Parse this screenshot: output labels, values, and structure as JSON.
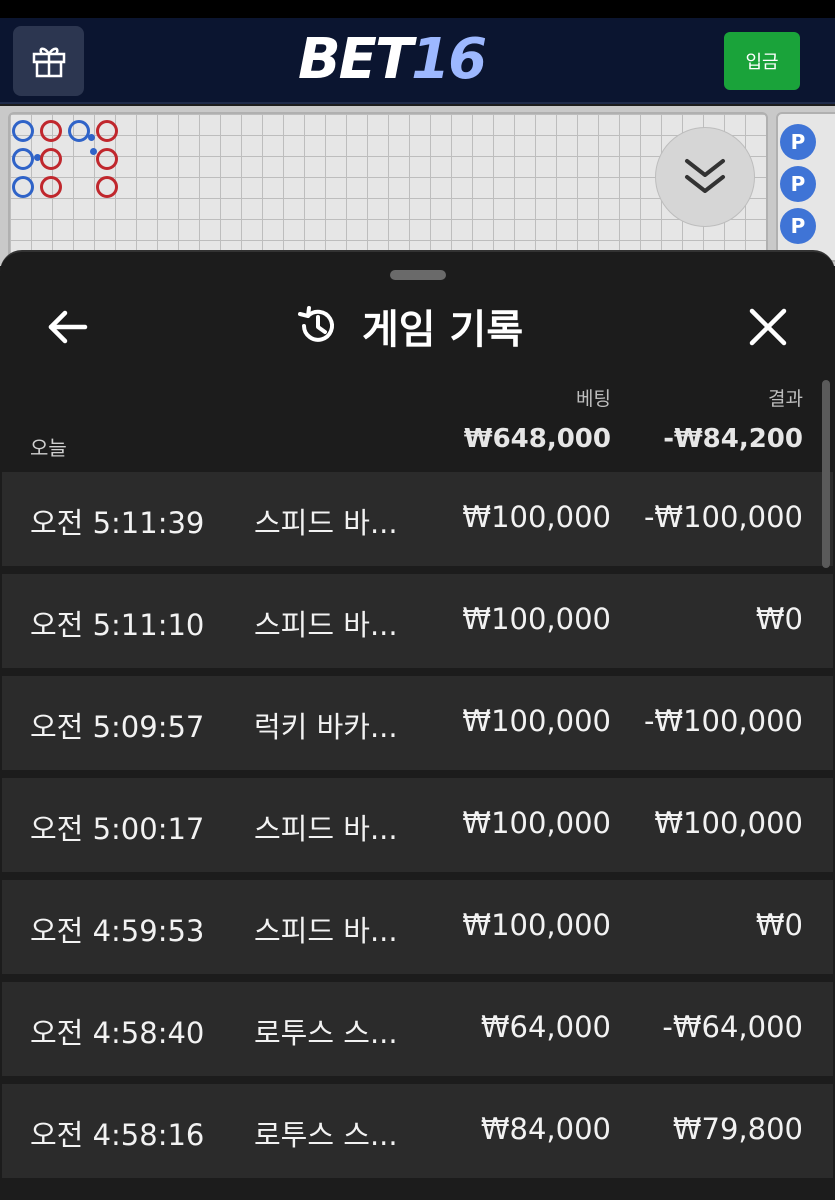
{
  "header": {
    "logo_text_main": "BET",
    "logo_text_accent": "16",
    "deposit_label": "입금"
  },
  "roadmap": {
    "side_chip_label": "P"
  },
  "sheet": {
    "title": "게임 기록",
    "columns": {
      "bet": "베팅",
      "result": "결과"
    },
    "today_label": "오늘",
    "total_bet": "₩648,000",
    "total_result": "-₩84,200",
    "rows": [
      {
        "time": "오전 5:11:39",
        "game": "스피드 바...",
        "bet": "₩100,000",
        "result": "-₩100,000"
      },
      {
        "time": "오전 5:11:10",
        "game": "스피드 바...",
        "bet": "₩100,000",
        "result": "₩0"
      },
      {
        "time": "오전 5:09:57",
        "game": "럭키 바카...",
        "bet": "₩100,000",
        "result": "-₩100,000"
      },
      {
        "time": "오전 5:00:17",
        "game": "스피드 바...",
        "bet": "₩100,000",
        "result": "₩100,000"
      },
      {
        "time": "오전 4:59:53",
        "game": "스피드 바...",
        "bet": "₩100,000",
        "result": "₩0"
      },
      {
        "time": "오전 4:58:40",
        "game": "로투스 스...",
        "bet": "₩64,000",
        "result": "-₩64,000"
      },
      {
        "time": "오전 4:58:16",
        "game": "로투스 스...",
        "bet": "₩84,000",
        "result": "₩79,800"
      }
    ]
  },
  "icons": {
    "gift": "gift-icon",
    "collapse": "chevron-double-down-icon",
    "back": "arrow-left-icon",
    "history": "history-icon",
    "close": "close-icon"
  }
}
